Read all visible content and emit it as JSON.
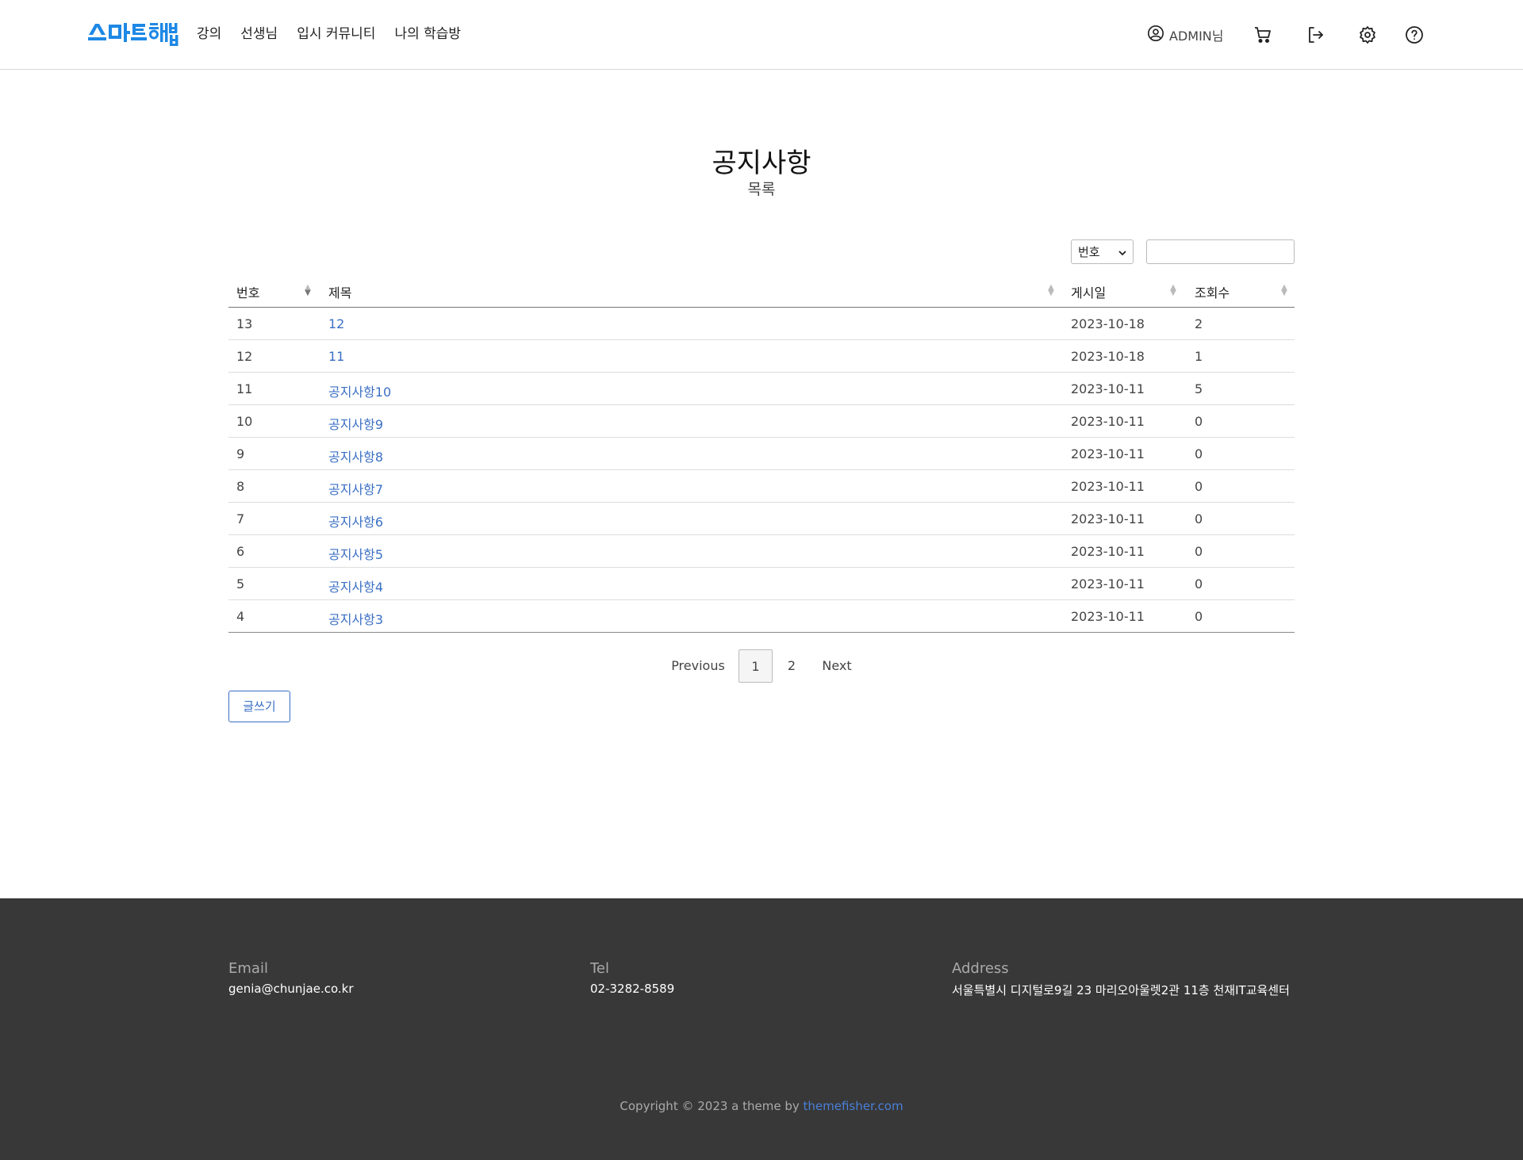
{
  "header": {
    "logo_text": "스마트해법",
    "nav": [
      "강의",
      "선생님",
      "입시 커뮤니티",
      "나의 학습방"
    ],
    "user_label": "ADMIN님",
    "icons": [
      "user-circle-icon",
      "cart-icon",
      "logout-icon",
      "gear-icon",
      "help-icon"
    ],
    "brand_color": "#1e88e5"
  },
  "page": {
    "title": "공지사항",
    "subtitle": "목록"
  },
  "search": {
    "select_value": "번호",
    "input_value": ""
  },
  "table": {
    "columns": [
      "번호",
      "제목",
      "게시일",
      "조회수"
    ],
    "rows": [
      {
        "no": "13",
        "title": "12",
        "date": "2023-10-18",
        "views": "2"
      },
      {
        "no": "12",
        "title": "11",
        "date": "2023-10-18",
        "views": "1"
      },
      {
        "no": "11",
        "title": "공지사항10",
        "date": "2023-10-11",
        "views": "5"
      },
      {
        "no": "10",
        "title": "공지사항9",
        "date": "2023-10-11",
        "views": "0"
      },
      {
        "no": "9",
        "title": "공지사항8",
        "date": "2023-10-11",
        "views": "0"
      },
      {
        "no": "8",
        "title": "공지사항7",
        "date": "2023-10-11",
        "views": "0"
      },
      {
        "no": "7",
        "title": "공지사항6",
        "date": "2023-10-11",
        "views": "0"
      },
      {
        "no": "6",
        "title": "공지사항5",
        "date": "2023-10-11",
        "views": "0"
      },
      {
        "no": "5",
        "title": "공지사항4",
        "date": "2023-10-11",
        "views": "0"
      },
      {
        "no": "4",
        "title": "공지사항3",
        "date": "2023-10-11",
        "views": "0"
      }
    ]
  },
  "pagination": {
    "previous": "Previous",
    "pages": [
      "1",
      "2"
    ],
    "current": "1",
    "next": "Next"
  },
  "write_button": "글쓰기",
  "footer": {
    "email_label": "Email",
    "email": "genia@chunjae.co.kr",
    "tel_label": "Tel",
    "tel": "02-3282-8589",
    "address_label": "Address",
    "address": "서울특별시 디지털로9길 23 마리오아울렛2관 11층 천재IT교육센터",
    "copyright_prefix": "Copyright © 2023 a theme by ",
    "copyright_link": "themefisher.com"
  }
}
